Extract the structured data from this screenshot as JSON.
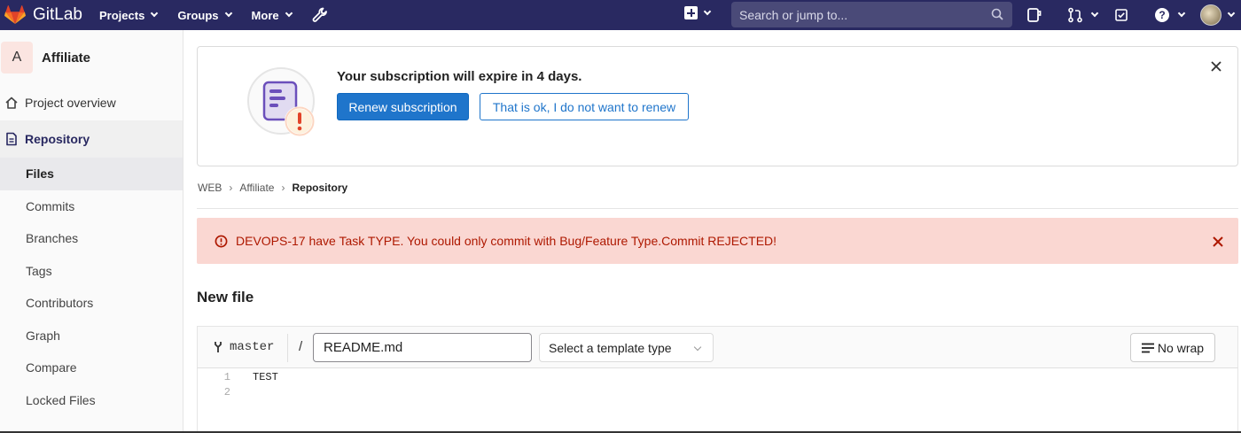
{
  "topnav": {
    "brand": "GitLab",
    "menu": [
      {
        "label": "Projects"
      },
      {
        "label": "Groups"
      },
      {
        "label": "More"
      }
    ],
    "search_placeholder": "Search or jump to...",
    "bg_color": "#292961"
  },
  "sidebar": {
    "project_avatar_letter": "A",
    "project_name": "Affiliate",
    "items": [
      {
        "label": "Project overview",
        "icon": "home-icon"
      },
      {
        "label": "Repository",
        "icon": "document-icon",
        "active": true
      }
    ],
    "sub_items": [
      {
        "label": "Files",
        "active": true
      },
      {
        "label": "Commits"
      },
      {
        "label": "Branches"
      },
      {
        "label": "Tags"
      },
      {
        "label": "Contributors"
      },
      {
        "label": "Graph"
      },
      {
        "label": "Compare"
      },
      {
        "label": "Locked Files"
      }
    ]
  },
  "banner": {
    "title": "Your subscription will expire in 4 days.",
    "renew_label": "Renew subscription",
    "decline_label": "That is ok, I do not want to renew"
  },
  "breadcrumb": {
    "items": [
      "WEB",
      "Affiliate"
    ],
    "current": "Repository"
  },
  "alert": {
    "message": "DEVOPS-17 have Task TYPE. You could only commit with Bug/Feature Type.Commit REJECTED!",
    "color": "#ae1800"
  },
  "page": {
    "title": "New file"
  },
  "editor": {
    "branch": "master",
    "separator": "/",
    "file_name": "README.md",
    "template_placeholder": "Select a template type",
    "wrap_label": "No wrap",
    "lines": [
      {
        "number": "1",
        "text": "TEST"
      },
      {
        "number": "2",
        "text": ""
      }
    ]
  }
}
